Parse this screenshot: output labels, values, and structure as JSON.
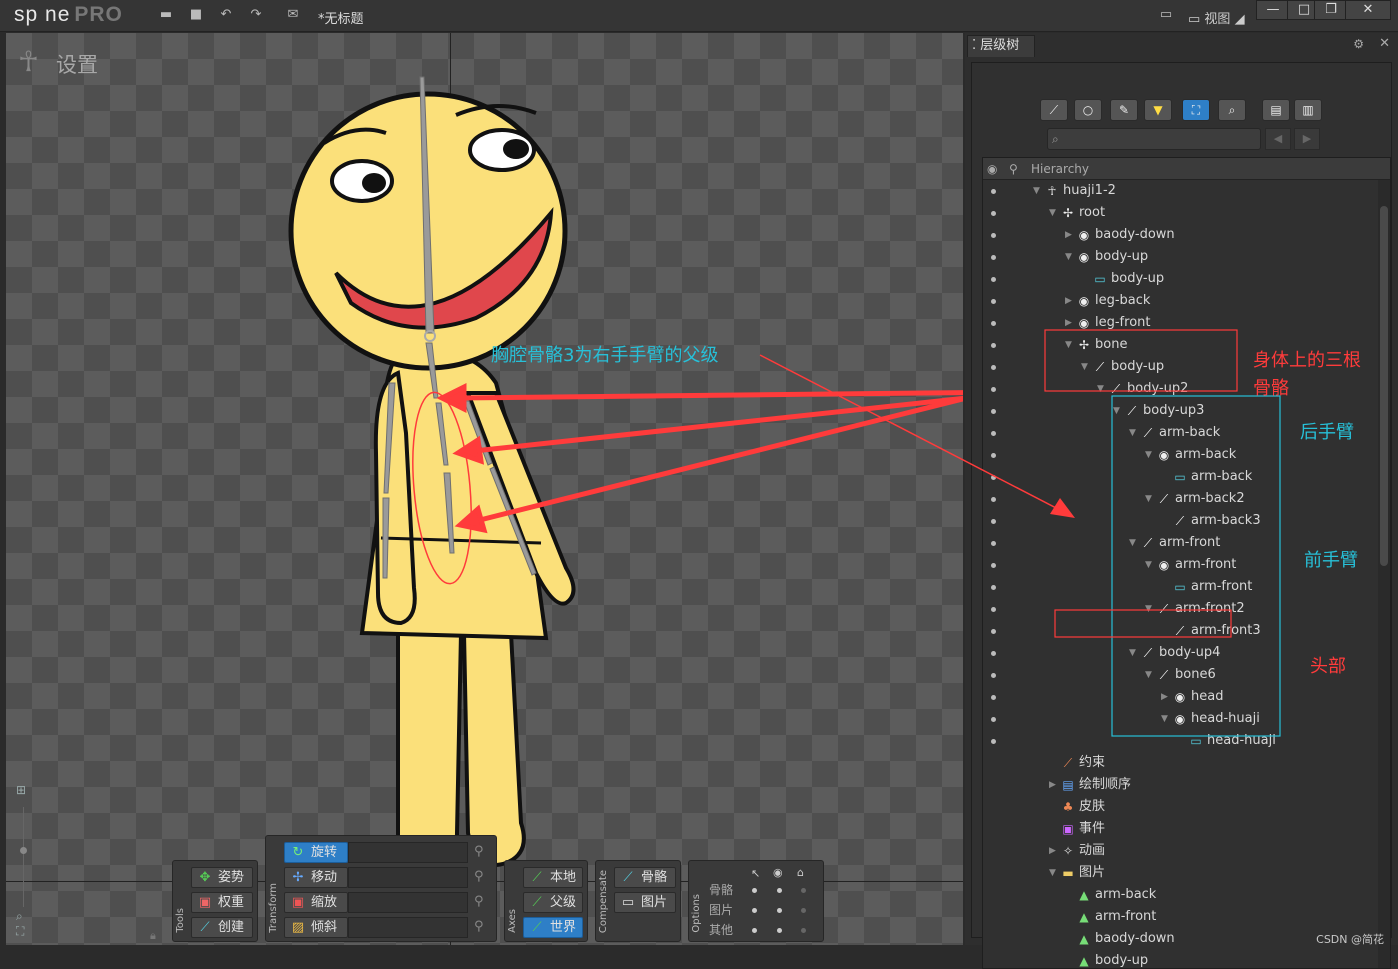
{
  "app": {
    "logo": "sp ne",
    "logo_suffix": "PRO",
    "document_title": "*无标题",
    "view_menu": "视图"
  },
  "viewport": {
    "mode_label": "设置",
    "annotation_cyan": "胸腔骨骼3为右手手臂的父级"
  },
  "toolbar": {
    "tools": {
      "group_label": "Tools",
      "pose": "姿势",
      "weights": "权重",
      "create": "创建"
    },
    "transform": {
      "group_label": "Transform",
      "rotate": "旋转",
      "translate": "移动",
      "scale": "缩放",
      "shear": "倾斜"
    },
    "axes": {
      "group_label": "Axes",
      "local": "本地",
      "parent": "父级",
      "world": "世界"
    },
    "compensate": {
      "group_label": "Compensate",
      "bones": "骨骼",
      "images": "图片"
    },
    "options": {
      "group_label": "Options",
      "rows": [
        "骨骼",
        "图片",
        "其他"
      ]
    }
  },
  "panel": {
    "tab": "层级树",
    "tree_header": "Hierarchy",
    "search_placeholder": "",
    "rows": [
      {
        "label": "huaji1-2",
        "icon": "skeleton-icon",
        "depth": 0,
        "tri": "open"
      },
      {
        "label": "root",
        "icon": "root-bone-icon",
        "depth": 1,
        "tri": "open"
      },
      {
        "label": "baody-down",
        "icon": "slot-icon",
        "depth": 2,
        "tri": "closed"
      },
      {
        "label": "body-up",
        "icon": "slot-icon",
        "depth": 2,
        "tri": "open"
      },
      {
        "label": "body-up",
        "icon": "attachment-icon",
        "depth": 3,
        "tri": ""
      },
      {
        "label": "leg-back",
        "icon": "slot-icon",
        "depth": 2,
        "tri": "closed"
      },
      {
        "label": "leg-front",
        "icon": "slot-icon",
        "depth": 2,
        "tri": "closed"
      },
      {
        "label": "bone",
        "icon": "root-bone-icon",
        "depth": 2,
        "tri": "open"
      },
      {
        "label": "body-up",
        "icon": "bone-icon",
        "depth": 3,
        "tri": "open"
      },
      {
        "label": "body-up2",
        "icon": "bone-icon",
        "depth": 4,
        "tri": "open"
      },
      {
        "label": "body-up3",
        "icon": "bone-icon",
        "depth": 5,
        "tri": "open"
      },
      {
        "label": "arm-back",
        "icon": "bone-icon",
        "depth": 6,
        "tri": "open"
      },
      {
        "label": "arm-back",
        "icon": "slot-icon",
        "depth": 7,
        "tri": "open"
      },
      {
        "label": "arm-back",
        "icon": "attachment-icon",
        "depth": 8,
        "tri": ""
      },
      {
        "label": "arm-back2",
        "icon": "bone-icon",
        "depth": 7,
        "tri": "open"
      },
      {
        "label": "arm-back3",
        "icon": "bone-icon",
        "depth": 8,
        "tri": ""
      },
      {
        "label": "arm-front",
        "icon": "bone-icon",
        "depth": 6,
        "tri": "open"
      },
      {
        "label": "arm-front",
        "icon": "slot-icon",
        "depth": 7,
        "tri": "open"
      },
      {
        "label": "arm-front",
        "icon": "attachment-icon",
        "depth": 8,
        "tri": ""
      },
      {
        "label": "arm-front2",
        "icon": "bone-icon",
        "depth": 7,
        "tri": "open"
      },
      {
        "label": "arm-front3",
        "icon": "bone-icon",
        "depth": 8,
        "tri": ""
      },
      {
        "label": "body-up4",
        "icon": "bone-icon",
        "depth": 6,
        "tri": "open"
      },
      {
        "label": "bone6",
        "icon": "bone-icon",
        "depth": 7,
        "tri": "open"
      },
      {
        "label": "head",
        "icon": "slot-icon",
        "depth": 8,
        "tri": "closed"
      },
      {
        "label": "head-huaji",
        "icon": "slot-icon",
        "depth": 8,
        "tri": "open"
      },
      {
        "label": "head-huaji",
        "icon": "attachment-icon",
        "depth": 9,
        "tri": ""
      }
    ],
    "sections": [
      {
        "label": "约束",
        "icon": "constraint-icon",
        "tri": ""
      },
      {
        "label": "绘制顺序",
        "icon": "draw-order-icon",
        "tri": "closed"
      },
      {
        "label": "皮肤",
        "icon": "skin-icon",
        "tri": ""
      },
      {
        "label": "事件",
        "icon": "event-icon",
        "tri": ""
      },
      {
        "label": "动画",
        "icon": "animation-icon",
        "tri": "closed"
      },
      {
        "label": "图片",
        "icon": "images-folder-icon",
        "tri": "open"
      }
    ],
    "images": [
      "arm-back",
      "arm-front",
      "baody-down",
      "body-up"
    ]
  },
  "annotations": {
    "body_bones": "身体上的三根",
    "body_bones_2": "骨骼",
    "back_arm": "后手臂",
    "front_arm": "前手臂",
    "head": "头部"
  },
  "watermark": "CSDN @简花",
  "colors": {
    "accent": "#2e7fc7",
    "annotation_red": "#ff3b3b",
    "annotation_cyan": "#27c0d8",
    "character_yellow": "#fbe07a"
  }
}
